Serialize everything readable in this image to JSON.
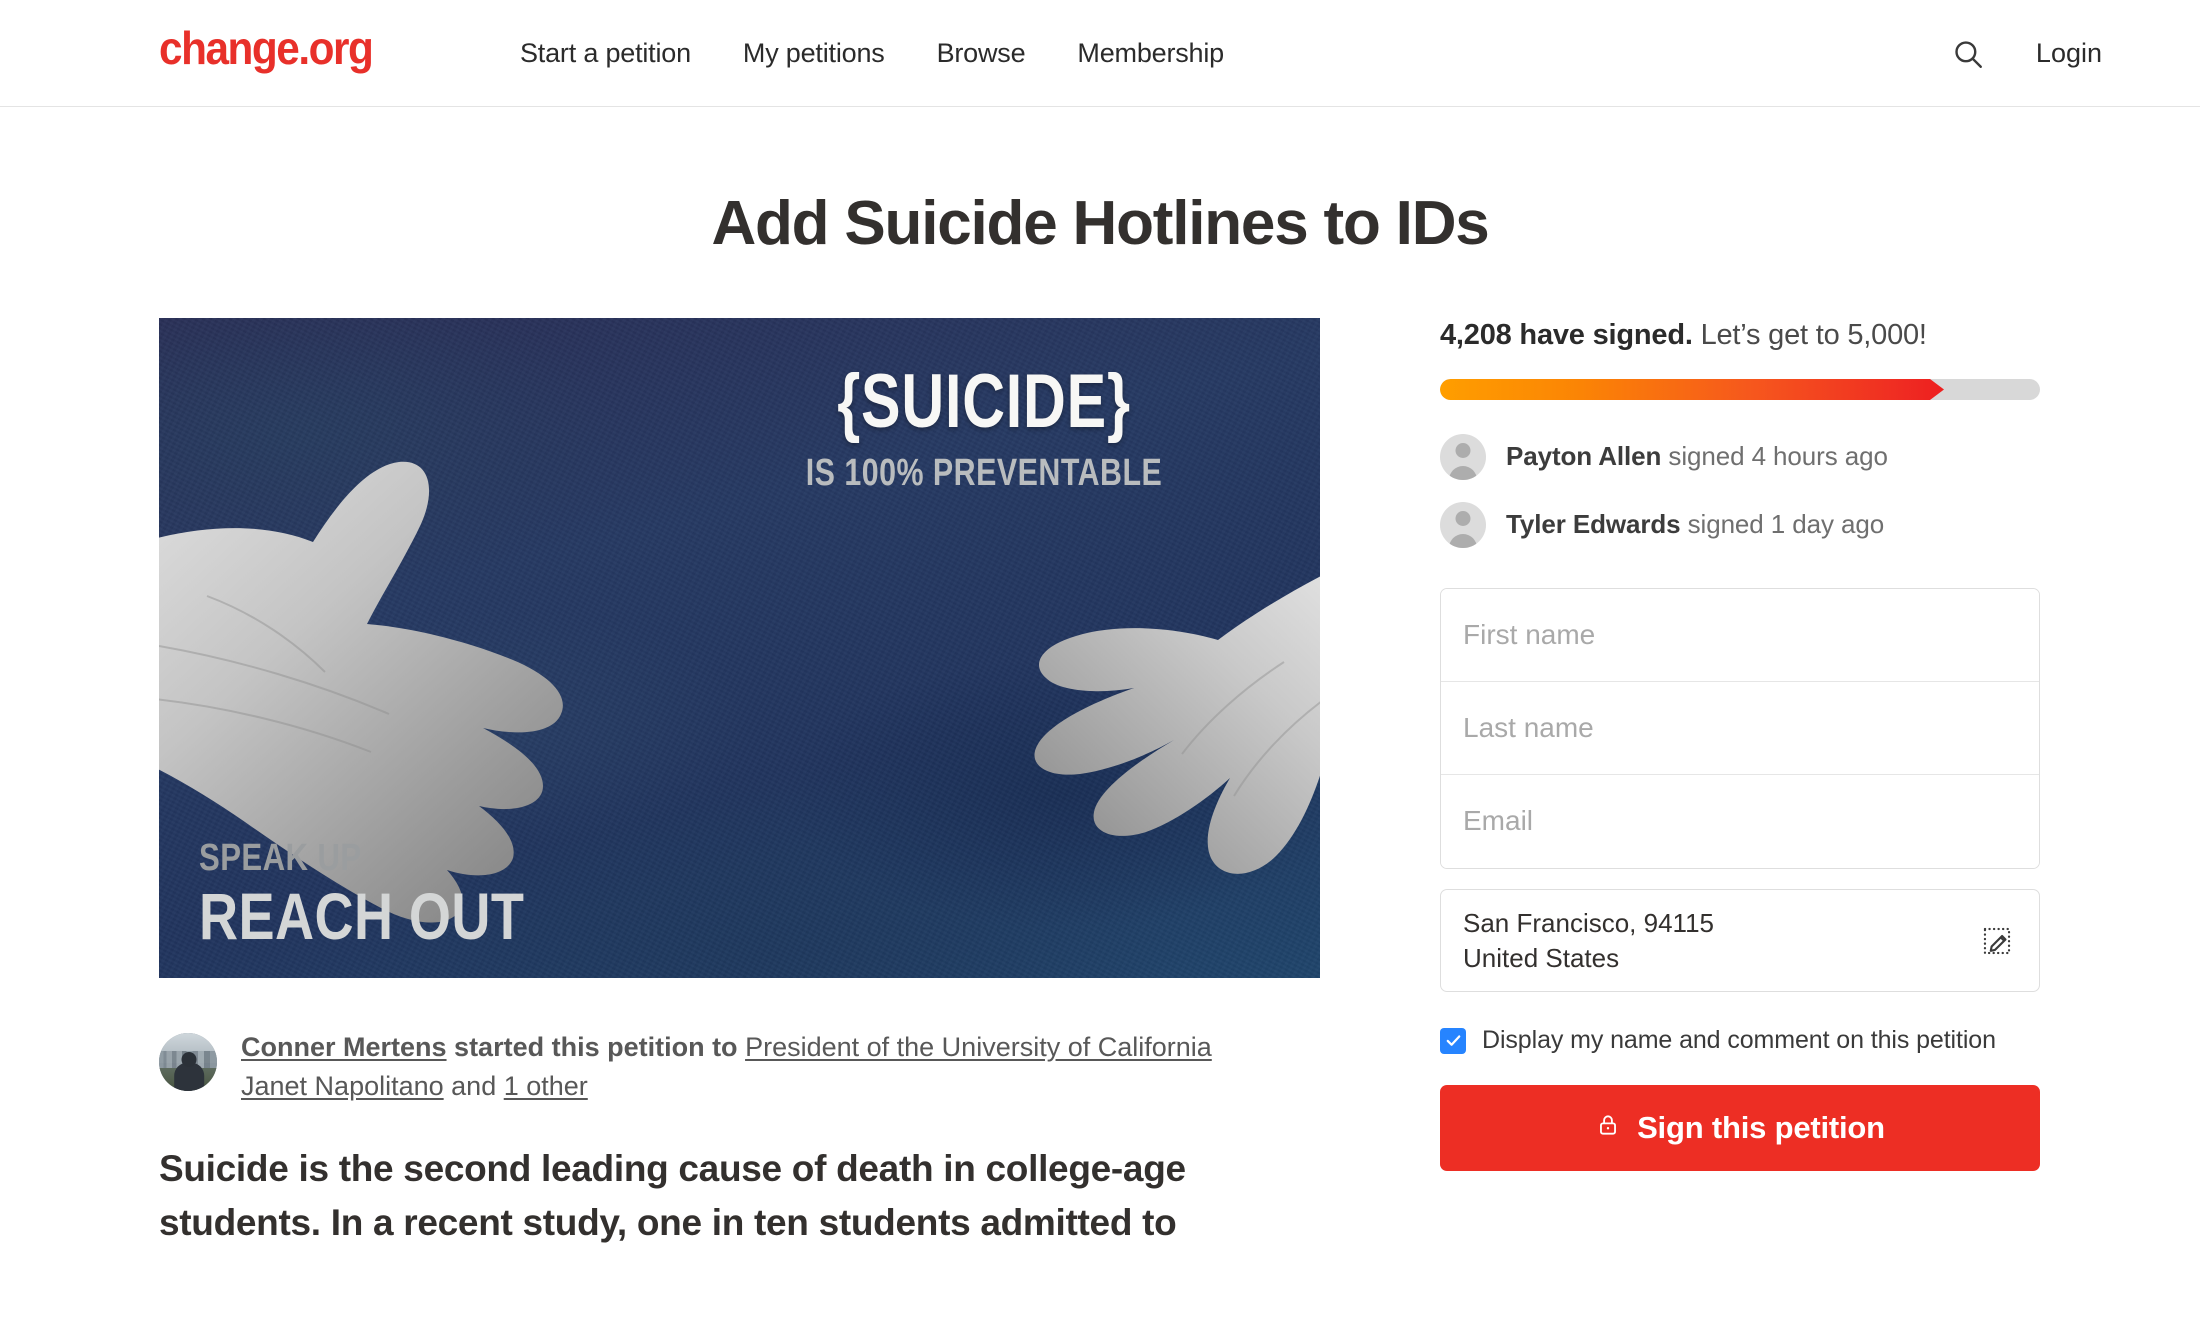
{
  "header": {
    "logo": "change.org",
    "nav": [
      {
        "label": "Start a petition"
      },
      {
        "label": "My petitions"
      },
      {
        "label": "Browse"
      },
      {
        "label": "Membership"
      }
    ],
    "search_icon": "search-icon",
    "login_label": "Login"
  },
  "petition": {
    "title": "Add Suicide Hotlines to IDs",
    "image": {
      "headline": "{SUICIDE}",
      "subhead": "IS 100% PREVENTABLE",
      "foot_top": "SPEAK UP",
      "foot_bottom": "REACH OUT",
      "alt": "Two grayscale hands reaching toward each other on a dark navy textured background"
    },
    "author": {
      "name": "Conner Mertens",
      "verb": " started this petition to ",
      "target": "President of the University of California Janet Napolitano",
      "conjunction": " and ",
      "others": "1 other"
    },
    "lede": "Suicide is the second leading cause of death in college-age students. In a recent study, one in ten students admitted to"
  },
  "sign_panel": {
    "signed_count": "4,208 have signed.",
    "goal_text": "Let’s get to 5,000!",
    "progress_percent": 84,
    "signers": [
      {
        "name": "Payton Allen",
        "meta": " signed 4 hours ago"
      },
      {
        "name": "Tyler Edwards",
        "meta": " signed 1 day ago"
      }
    ],
    "fields": {
      "first_name_placeholder": "First name",
      "first_name_value": "",
      "last_name_placeholder": "Last name",
      "last_name_value": "",
      "email_placeholder": "Email",
      "email_value": ""
    },
    "location": {
      "line1": "San Francisco, 94115",
      "line2": "United States",
      "edit_icon": "edit-pencil-icon"
    },
    "consent": {
      "checked": true,
      "label": "Display my name and comment on this petition"
    },
    "submit": {
      "label": "Sign this petition",
      "icon": "lock-icon"
    }
  },
  "colors": {
    "brand_red": "#e8302a",
    "button_red": "#ed2e24",
    "progress_start": "#ff9e00",
    "progress_end": "#ed1f1f",
    "checkbox_blue": "#2684ff",
    "text_dark": "#33302e"
  }
}
